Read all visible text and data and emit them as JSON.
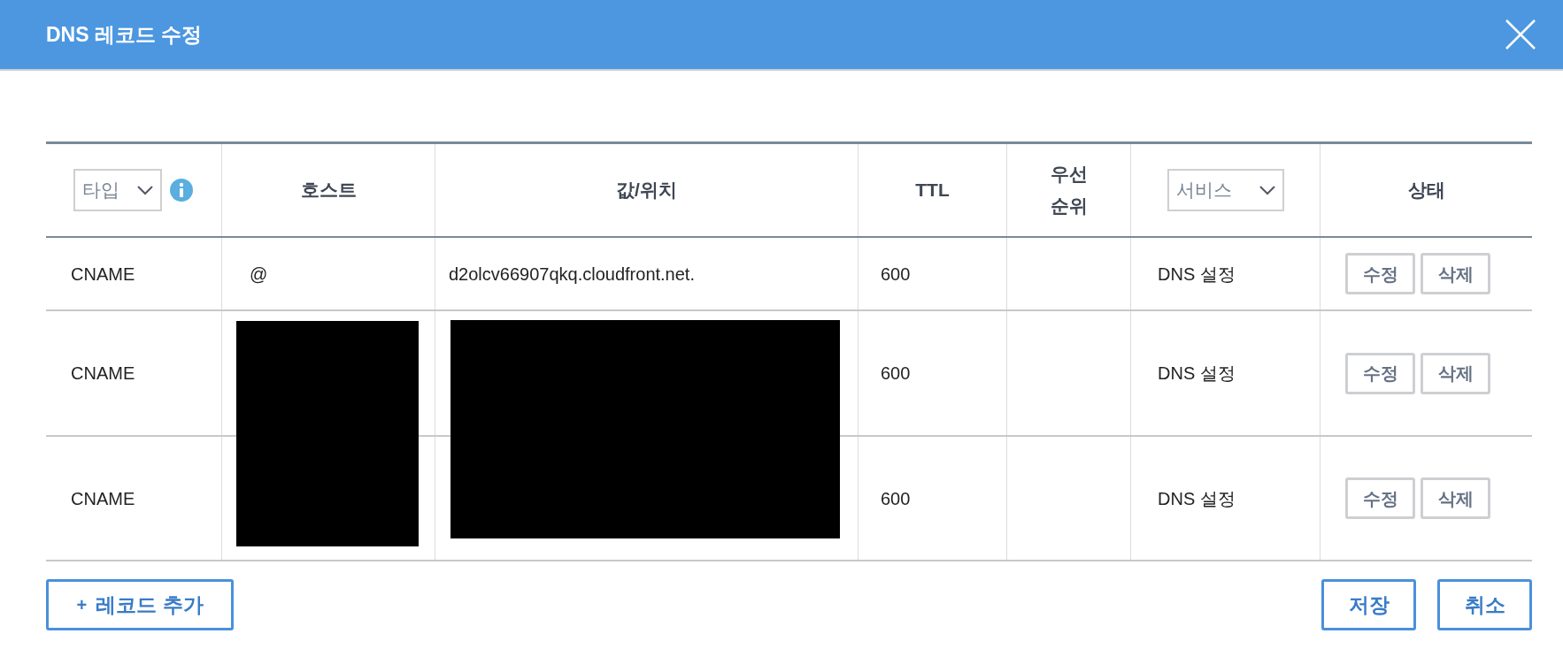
{
  "dialog": {
    "title": "DNS 레코드 수정"
  },
  "table": {
    "columns": [
      {
        "kind": "select",
        "label": "타입",
        "info": true
      },
      {
        "kind": "text",
        "label": "호스트"
      },
      {
        "kind": "text",
        "label": "값/위치"
      },
      {
        "kind": "text",
        "label": "TTL"
      },
      {
        "kind": "text",
        "label": "우선\n순위"
      },
      {
        "kind": "select",
        "label": "서비스",
        "info": false
      },
      {
        "kind": "text",
        "label": "상태"
      }
    ],
    "rows": [
      {
        "type": "CNAME",
        "host": "@",
        "value": "d2olcv66907qkq.cloudfront.net.",
        "ttl": "600",
        "service": "DNS 설정",
        "redacted": false,
        "actions": [
          "수정",
          "삭제"
        ]
      },
      {
        "type": "CNAME",
        "ttl": "600",
        "service": "DNS 설정",
        "redacted": true,
        "actions": [
          "수정",
          "삭제"
        ]
      },
      {
        "type": "CNAME",
        "ttl": "600",
        "service": "DNS 설정",
        "redacted": true,
        "actions": [
          "수정",
          "삭제"
        ]
      }
    ]
  },
  "footer": {
    "add_button": {
      "icon": "+",
      "label": "레코드 추가"
    },
    "buttons": [
      "저장",
      "취소"
    ]
  }
}
